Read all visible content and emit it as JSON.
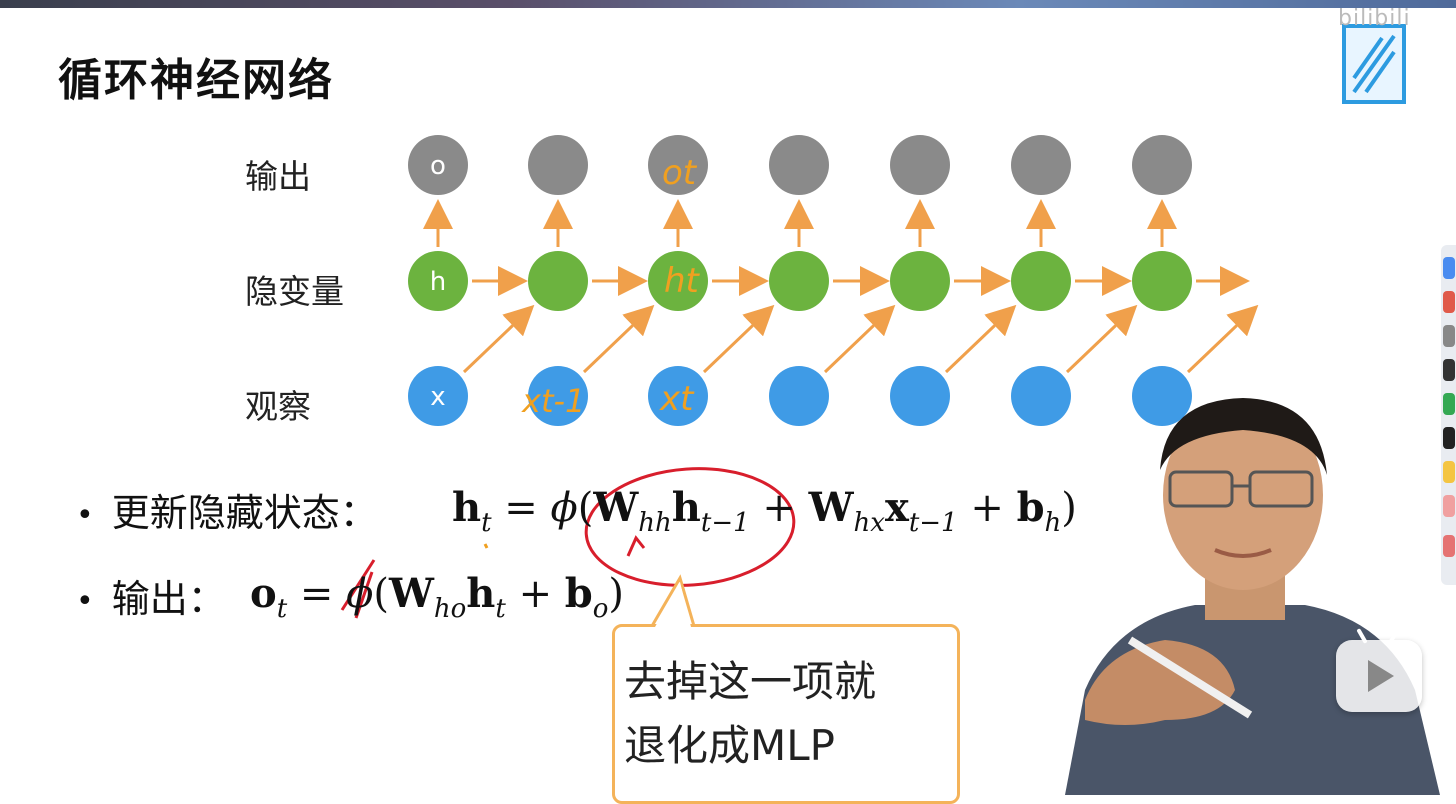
{
  "slide": {
    "title": "循环神经网络",
    "row_labels": {
      "output": "输出",
      "hidden": "隐变量",
      "observation": "观察"
    },
    "node_labels": {
      "output": "o",
      "hidden": "h",
      "input": "x"
    },
    "annotations": {
      "ot": "ot",
      "ht": "ht",
      "xt": "xt",
      "xt_minus_1": "xt-1"
    },
    "bullets": [
      {
        "label": "更新隐藏状态："
      },
      {
        "label": "输出："
      }
    ],
    "formula_hidden": {
      "h": "h",
      "t": "t",
      "eq": "=",
      "phi": "ϕ",
      "lp": "(",
      "W1": "W",
      "hh": "hh",
      "h2": "h",
      "tm1": "t−1",
      "plus1": "+",
      "W2": "W",
      "hx": "hx",
      "x": "x",
      "tm1b": "t−1",
      "plus2": "+",
      "b": "b",
      "bh": "h",
      "rp": ")"
    },
    "formula_output": {
      "o": "o",
      "t": "t",
      "eq": "=",
      "phi": "ϕ",
      "lp": "(",
      "W": "W",
      "ho": "ho",
      "h": "h",
      "t2": "t",
      "plus": "+",
      "b": "b",
      "bo": "o",
      "rp": ")"
    },
    "callout": {
      "line1": "去掉这一项就",
      "line2": "退化成MLP"
    }
  },
  "colors": {
    "output_node": "#8a8a8a",
    "hidden_node": "#6cb33f",
    "input_node": "#3f9be6",
    "arrow": "#f0a04b",
    "red_ink": "#d81e2c",
    "callout_border": "#f4b35a",
    "handwriting": "#f0a020"
  },
  "overlay": {
    "logo_text": "bilibili",
    "play_button_icon": "play-icon"
  }
}
